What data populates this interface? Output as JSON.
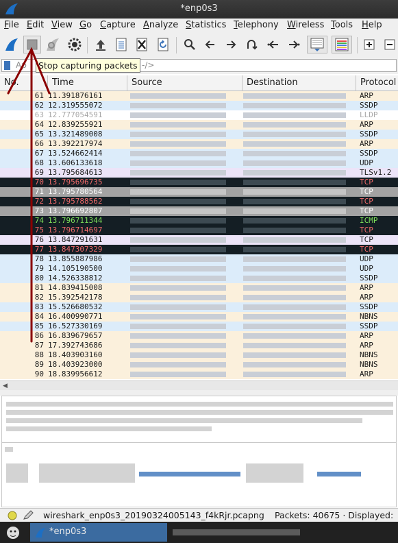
{
  "window": {
    "title": "*enp0s3"
  },
  "menu": [
    "File",
    "Edit",
    "View",
    "Go",
    "Capture",
    "Analyze",
    "Statistics",
    "Telephony",
    "Wireless",
    "Tools",
    "Help"
  ],
  "tooltip": "Stop capturing packets",
  "filter": {
    "placeholder_start": "Ap",
    "placeholder_end": "‑/>"
  },
  "columns": [
    "No.",
    "Time",
    "Source",
    "Destination",
    "Protocol"
  ],
  "packets": [
    {
      "no": "61",
      "time": "11.391876161",
      "proto": "ARP",
      "bg": "#fbf0dc",
      "fg": "#1a1a1a"
    },
    {
      "no": "62",
      "time": "12.319555072",
      "proto": "SSDP",
      "bg": "#dcecfa",
      "fg": "#1a1a1a"
    },
    {
      "no": "63",
      "time": "12.777054591",
      "proto": "LLDP",
      "bg": "#ffffff",
      "fg": "#a8a8a8"
    },
    {
      "no": "64",
      "time": "12.839255921",
      "proto": "ARP",
      "bg": "#fbf0dc",
      "fg": "#1a1a1a"
    },
    {
      "no": "65",
      "time": "13.321489008",
      "proto": "SSDP",
      "bg": "#dcecfa",
      "fg": "#1a1a1a"
    },
    {
      "no": "66",
      "time": "13.392217974",
      "proto": "ARP",
      "bg": "#fbf0dc",
      "fg": "#1a1a1a"
    },
    {
      "no": "67",
      "time": "13.524662414",
      "proto": "SSDP",
      "bg": "#dcecfa",
      "fg": "#1a1a1a"
    },
    {
      "no": "68",
      "time": "13.606133618",
      "proto": "UDP",
      "bg": "#dcecfa",
      "fg": "#1a1a1a"
    },
    {
      "no": "69",
      "time": "13.795684613",
      "proto": "TLSv1.2",
      "bg": "#ece4f8",
      "fg": "#1a1a1a"
    },
    {
      "no": "70",
      "time": "13.795696735",
      "proto": "TCP",
      "bg": "#141e24",
      "fg": "#f06a6a"
    },
    {
      "no": "71",
      "time": "13.795780564",
      "proto": "TCP",
      "bg": "#a3a3a3",
      "fg": "#ffffff"
    },
    {
      "no": "72",
      "time": "13.795788562",
      "proto": "TCP",
      "bg": "#141e24",
      "fg": "#f06a6a"
    },
    {
      "no": "73",
      "time": "13.796692807",
      "proto": "TCP",
      "bg": "#a3a3a3",
      "fg": "#ffffff"
    },
    {
      "no": "74",
      "time": "13.796711344",
      "proto": "ICMP",
      "bg": "#141e24",
      "fg": "#7ee05a"
    },
    {
      "no": "75",
      "time": "13.796714697",
      "proto": "TCP",
      "bg": "#141e24",
      "fg": "#f06a6a"
    },
    {
      "no": "76",
      "time": "13.847291631",
      "proto": "TCP",
      "bg": "#ece4f8",
      "fg": "#1a1a1a"
    },
    {
      "no": "77",
      "time": "13.847307329",
      "proto": "TCP",
      "bg": "#141e24",
      "fg": "#f06a6a"
    },
    {
      "no": "78",
      "time": "13.855887986",
      "proto": "UDP",
      "bg": "#dcecfa",
      "fg": "#1a1a1a"
    },
    {
      "no": "79",
      "time": "14.105190500",
      "proto": "UDP",
      "bg": "#dcecfa",
      "fg": "#1a1a1a"
    },
    {
      "no": "80",
      "time": "14.526338812",
      "proto": "SSDP",
      "bg": "#dcecfa",
      "fg": "#1a1a1a"
    },
    {
      "no": "81",
      "time": "14.839415008",
      "proto": "ARP",
      "bg": "#fbf0dc",
      "fg": "#1a1a1a"
    },
    {
      "no": "82",
      "time": "15.392542178",
      "proto": "ARP",
      "bg": "#fbf0dc",
      "fg": "#1a1a1a"
    },
    {
      "no": "83",
      "time": "15.526680532",
      "proto": "SSDP",
      "bg": "#dcecfa",
      "fg": "#1a1a1a"
    },
    {
      "no": "84",
      "time": "16.400990771",
      "proto": "NBNS",
      "bg": "#fbf0dc",
      "fg": "#1a1a1a"
    },
    {
      "no": "85",
      "time": "16.527330169",
      "proto": "SSDP",
      "bg": "#dcecfa",
      "fg": "#1a1a1a"
    },
    {
      "no": "86",
      "time": "16.839679657",
      "proto": "ARP",
      "bg": "#fbf0dc",
      "fg": "#1a1a1a"
    },
    {
      "no": "87",
      "time": "17.392743686",
      "proto": "ARP",
      "bg": "#fbf0dc",
      "fg": "#1a1a1a"
    },
    {
      "no": "88",
      "time": "18.403903160",
      "proto": "NBNS",
      "bg": "#fbf0dc",
      "fg": "#1a1a1a"
    },
    {
      "no": "89",
      "time": "18.403923000",
      "proto": "NBNS",
      "bg": "#fbf0dc",
      "fg": "#1a1a1a"
    },
    {
      "no": "90",
      "time": "18.839956612",
      "proto": "ARP",
      "bg": "#fbf0dc",
      "fg": "#1a1a1a"
    }
  ],
  "status": {
    "file": "wireshark_enp0s3_20190324005143_f4kRjr.pcapng",
    "packets": "Packets: 40675 · Displayed:"
  },
  "taskbar": {
    "task_label": "*enp0s3"
  },
  "colors": {
    "annotation_arrow": "#8b0000",
    "selection": "#3b73b9"
  }
}
